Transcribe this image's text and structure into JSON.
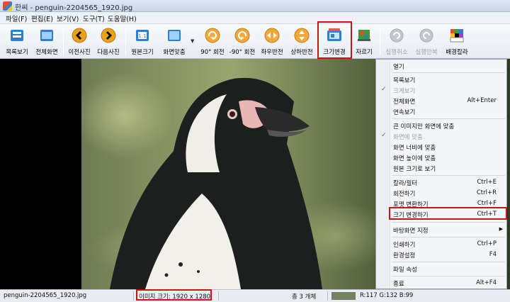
{
  "window": {
    "title": "한씨 - penguin-2204565_1920.jpg"
  },
  "menu": [
    "파일(F)",
    "편집(E)",
    "보기(V)",
    "도구(T)",
    "도움말(H)"
  ],
  "toolbar": {
    "list_view": "목록보기",
    "fullscreen": "전체화면",
    "prev_photo": "이전사진",
    "next_photo": "다음사진",
    "original_size": "원본크기",
    "fit_screen": "화면맞춤",
    "rotate_cw": "90° 회전",
    "rotate_ccw": "-90° 회전",
    "flip_h": "좌우반전",
    "flip_v": "상하반전",
    "resize": "크기변경",
    "crop": "자르기",
    "undo": "실행취소",
    "redo": "실행반복",
    "bg_color": "배경칼라"
  },
  "context_menu": {
    "items": [
      {
        "label": "열기",
        "shortcut": ""
      },
      {
        "label": "목록보기",
        "shortcut": ""
      },
      {
        "label": "크게보기",
        "shortcut": "",
        "disabled": true,
        "checked": true
      },
      {
        "label": "전체화면",
        "shortcut": "Alt+Enter"
      },
      {
        "label": "연속보기",
        "shortcut": ""
      },
      {
        "label": "큰 이미지만 화면에 맞춤",
        "shortcut": ""
      },
      {
        "label": "화면에 맞춤",
        "shortcut": "",
        "disabled": true,
        "checked": true
      },
      {
        "label": "화면 너비에 맞춤",
        "shortcut": ""
      },
      {
        "label": "화면 높이에 맞춤",
        "shortcut": ""
      },
      {
        "label": "원본 크기로 보기",
        "shortcut": ""
      },
      {
        "label": "칼라/필터",
        "shortcut": "Ctrl+E"
      },
      {
        "label": "회전하기",
        "shortcut": "Ctrl+R"
      },
      {
        "label": "포맷 변환하기",
        "shortcut": "Ctrl+F"
      },
      {
        "label": "크기 변경하기",
        "shortcut": "Ctrl+T"
      },
      {
        "label": "바탕화면 지정",
        "shortcut": "",
        "submenu": true
      },
      {
        "label": "인쇄하기",
        "shortcut": "Ctrl+P"
      },
      {
        "label": "환경설정",
        "shortcut": "F4"
      },
      {
        "label": "파일 속성",
        "shortcut": ""
      },
      {
        "label": "종료",
        "shortcut": "Alt+F4"
      }
    ]
  },
  "status": {
    "filename": "penguin-2204565_1920.jpg",
    "image_size": "이미지 크기: 1920 x 1280",
    "count": "총 3 개체",
    "rgb": "R:117 G:132 B:99",
    "swatch_color": "#75845f"
  },
  "colors": {
    "highlight": "#c81414"
  }
}
